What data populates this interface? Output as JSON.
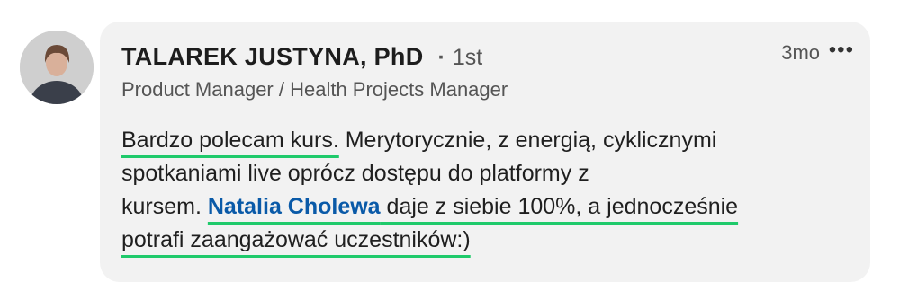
{
  "comment": {
    "author_name": "TALAREK JUSTYNA, PhD",
    "connection_degree": "1st",
    "headline": "Product Manager / Health Projects Manager",
    "time_ago": "3mo",
    "more_label": "•••",
    "text": {
      "part1": "Bardzo polecam kurs.",
      "part2": " Merytorycznie, z energią, cyklicznymi",
      "line2": "spotkaniami live oprócz dostępu do platformy z",
      "line3_start": "kursem. ",
      "mention": "Natalia Cholewa",
      "line3_end": " daje z siebie 100%, a jednocześnie",
      "line4": "potrafi zaangażować uczestników:)"
    }
  },
  "colors": {
    "card_bg": "#f2f2f2",
    "mention": "#0a5aa8",
    "highlight_underline": "#1fca6b"
  }
}
